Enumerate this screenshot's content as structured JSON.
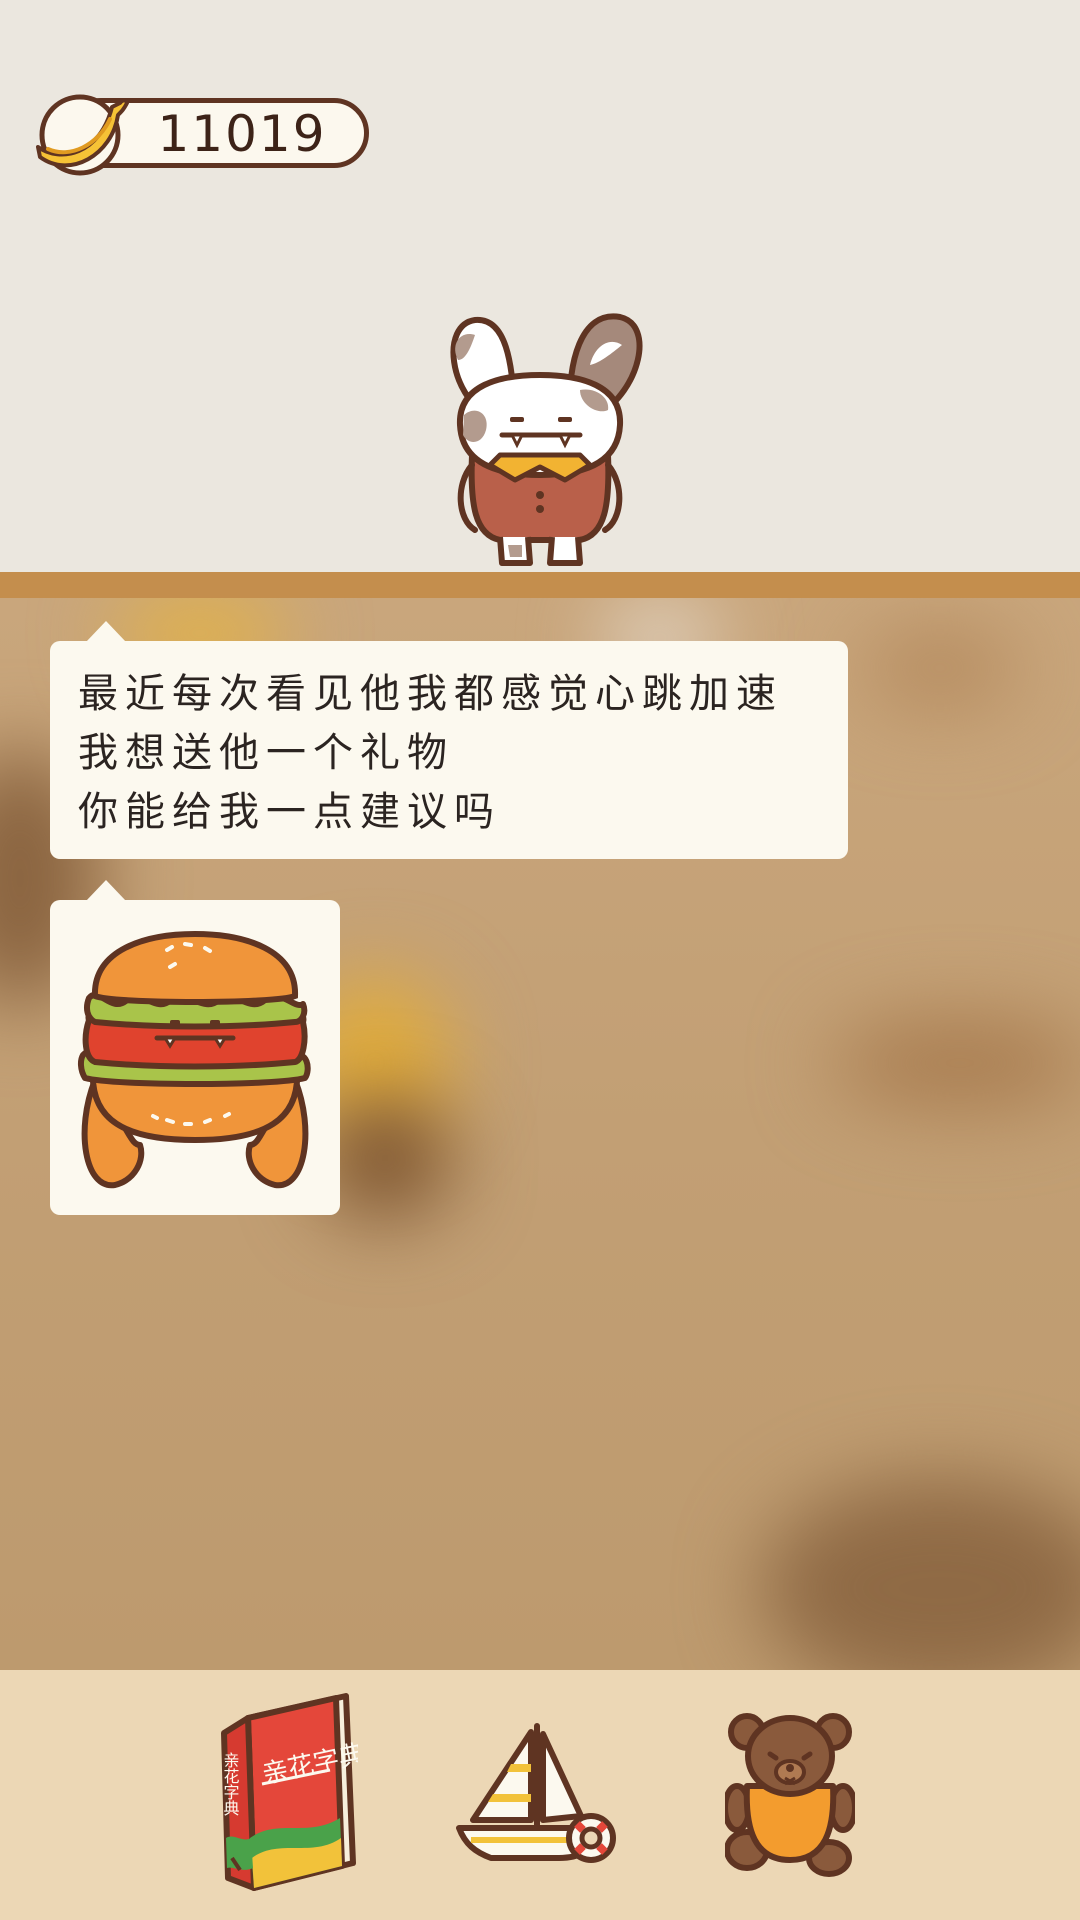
{
  "currency": {
    "icon": "banana-icon",
    "value": "11019"
  },
  "character": {
    "icon": "bunny-character"
  },
  "chat": {
    "message_lines": [
      "最近每次看见他我都感觉心跳加速",
      "我想送他一个礼物",
      "你能给我一点建议吗"
    ],
    "image_icon": "burger-creature-icon"
  },
  "bottom_nav": {
    "dictionary": {
      "icon": "dictionary-book-icon",
      "cover_title": "亲花字典",
      "spine_title": "亲花字典"
    },
    "boat": {
      "icon": "sailboat-icon"
    },
    "bear": {
      "icon": "teddy-bear-icon"
    }
  },
  "colors": {
    "background_top": "#ebe7df",
    "shelf": "#c48e4d",
    "bubble": "#fcf9ef",
    "bottom_bar": "#ecd7b5",
    "outline": "#5f3422"
  }
}
